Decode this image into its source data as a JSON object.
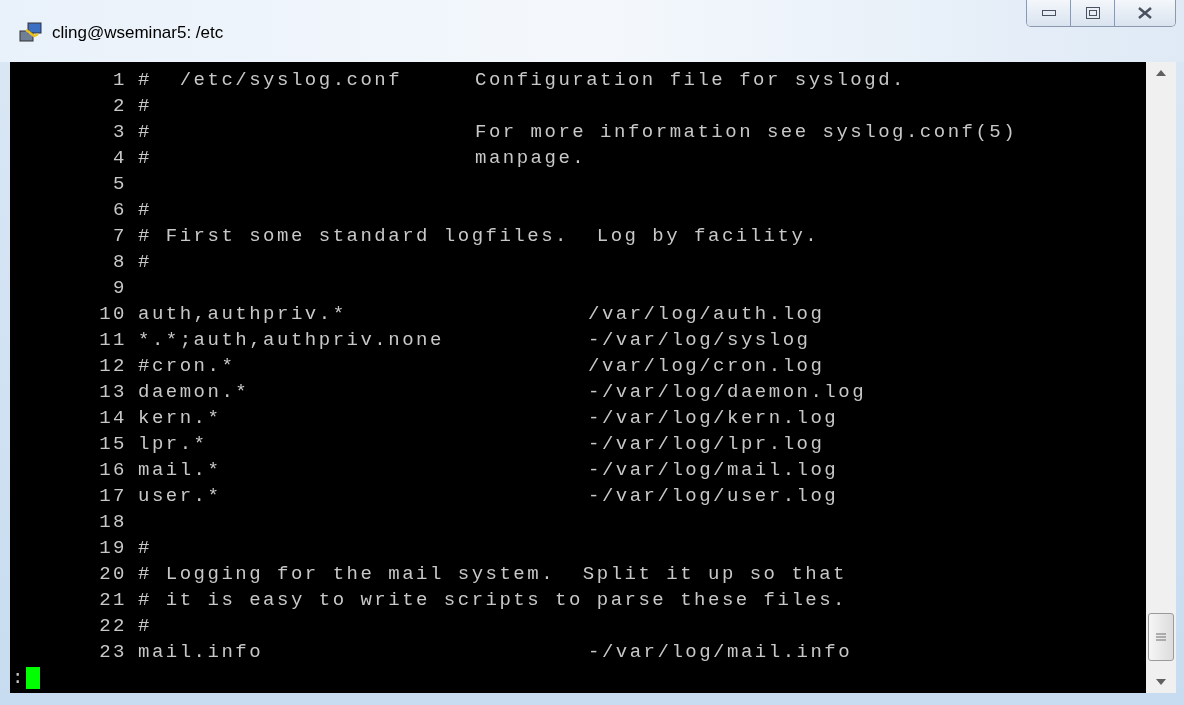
{
  "window": {
    "title": "cling@wseminar5: /etc"
  },
  "lines": [
    {
      "number": "1",
      "kind": "header",
      "text": "#  /etc/syslog.conf",
      "note": "Configuration file for syslogd."
    },
    {
      "number": "2",
      "kind": "plain",
      "text": "#"
    },
    {
      "number": "3",
      "kind": "header",
      "text": "#",
      "note": "For more information see syslog.conf(5)"
    },
    {
      "number": "4",
      "kind": "header",
      "text": "#",
      "note": "manpage."
    },
    {
      "number": "5",
      "kind": "plain"
    },
    {
      "number": "6",
      "kind": "plain",
      "text": "#"
    },
    {
      "number": "7",
      "kind": "plain",
      "text": "# First some standard logfiles.  Log by facility."
    },
    {
      "number": "8",
      "kind": "plain",
      "text": "#"
    },
    {
      "number": "9",
      "kind": "plain"
    },
    {
      "number": "10",
      "kind": "rule",
      "text": "auth,authpriv.*",
      "note": "/var/log/auth.log"
    },
    {
      "number": "11",
      "kind": "rule",
      "text": "*.*;auth,authpriv.none",
      "note": "-/var/log/syslog"
    },
    {
      "number": "12",
      "kind": "rule",
      "text": "#cron.*",
      "note": "/var/log/cron.log"
    },
    {
      "number": "13",
      "kind": "rule",
      "text": "daemon.*",
      "note": "-/var/log/daemon.log"
    },
    {
      "number": "14",
      "kind": "rule",
      "text": "kern.*",
      "note": "-/var/log/kern.log"
    },
    {
      "number": "15",
      "kind": "rule",
      "text": "lpr.*",
      "note": "-/var/log/lpr.log"
    },
    {
      "number": "16",
      "kind": "rule",
      "text": "mail.*",
      "note": "-/var/log/mail.log"
    },
    {
      "number": "17",
      "kind": "rule",
      "text": "user.*",
      "note": "-/var/log/user.log"
    },
    {
      "number": "18",
      "kind": "plain"
    },
    {
      "number": "19",
      "kind": "plain",
      "text": "#"
    },
    {
      "number": "20",
      "kind": "plain",
      "text": "# Logging for the mail system.  Split it up so that"
    },
    {
      "number": "21",
      "kind": "plain",
      "text": "# it is easy to write scripts to parse these files."
    },
    {
      "number": "22",
      "kind": "plain",
      "text": "#"
    },
    {
      "number": "23",
      "kind": "rule",
      "text": "mail.info",
      "note": "-/var/log/mail.info"
    }
  ],
  "prompt": {
    "text": ":"
  }
}
